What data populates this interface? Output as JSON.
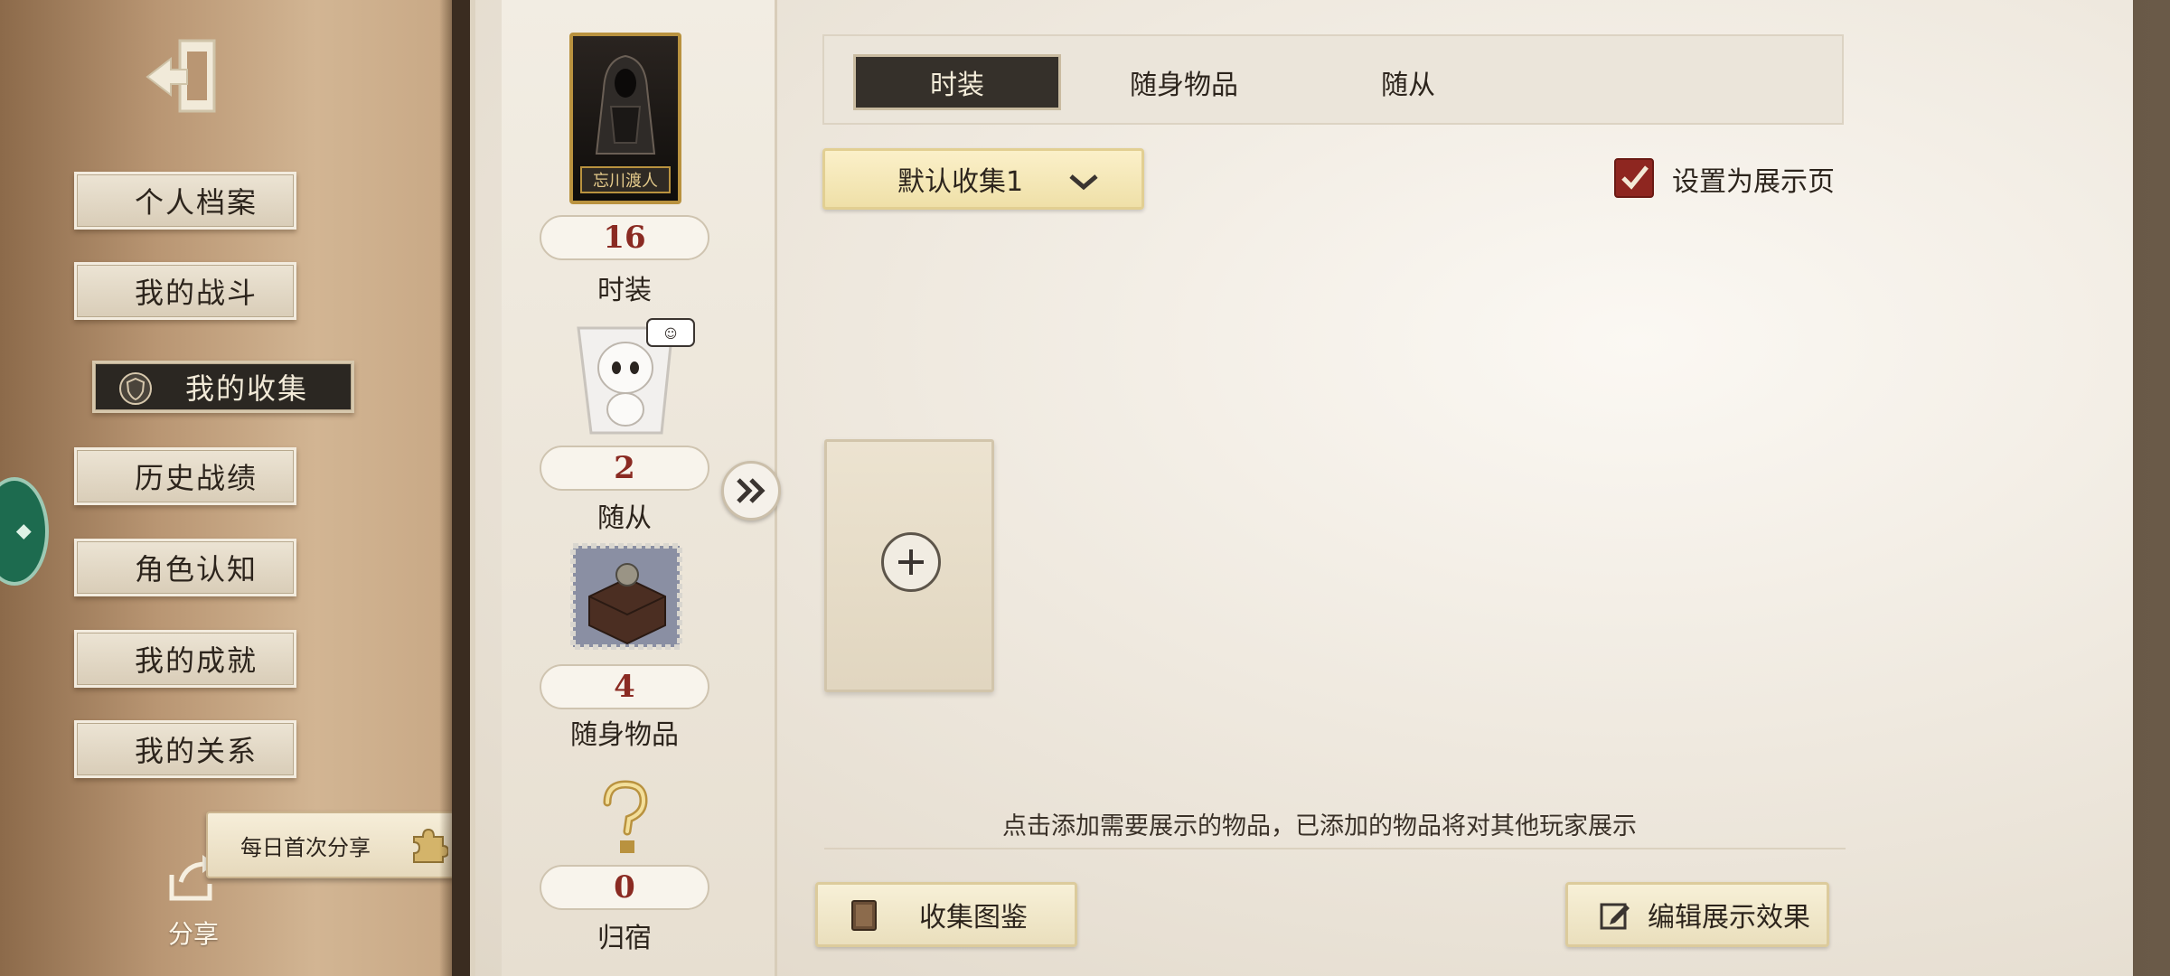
{
  "sidebar": {
    "items": [
      {
        "label": "个人档案"
      },
      {
        "label": "我的战斗"
      },
      {
        "label": "我的收集"
      },
      {
        "label": "历史战绩"
      },
      {
        "label": "角色认知"
      },
      {
        "label": "我的成就"
      },
      {
        "label": "我的关系"
      }
    ],
    "active_index": 2,
    "share_tip": "每日首次分享",
    "share_label": "分享"
  },
  "counters": [
    {
      "value": "16",
      "label": "时装",
      "card_name": "忘川渡人"
    },
    {
      "value": "2",
      "label": "随从"
    },
    {
      "value": "4",
      "label": "随身物品"
    },
    {
      "value": "0",
      "label": "归宿"
    }
  ],
  "tabs": [
    {
      "label": "时装",
      "active": true
    },
    {
      "label": "随身物品",
      "active": false
    },
    {
      "label": "随从",
      "active": false
    }
  ],
  "collection": {
    "selected": "默认收集1",
    "showcase_label": "设置为展示页",
    "showcase_checked": true
  },
  "hint": "点击添加需要展示的物品，已添加的物品将对其他玩家展示",
  "buttons": {
    "collection_book": "收集图鉴",
    "edit_display": "编辑展示效果"
  },
  "colors": {
    "count_red": "#8a2a22",
    "active_dark": "#35302a",
    "dropdown_yellow": "#efe0a8",
    "check_red": "#8e2620"
  }
}
